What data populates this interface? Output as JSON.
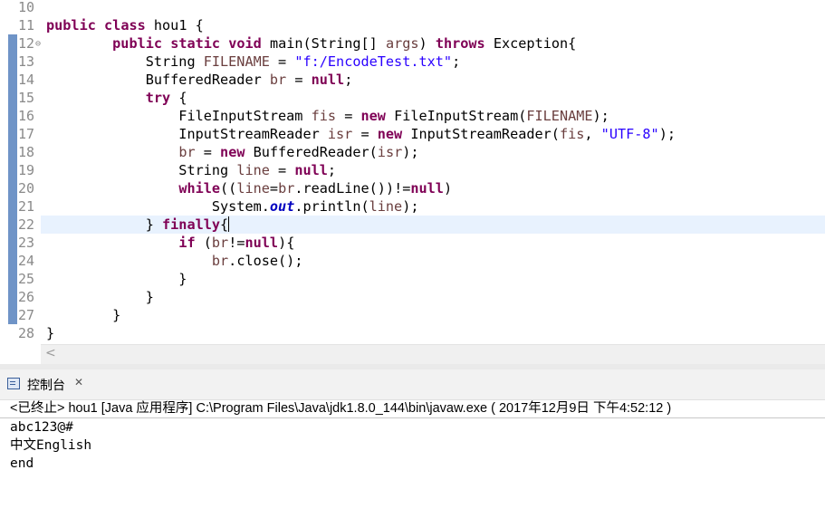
{
  "editor": {
    "line_numbers": [
      "10",
      "11",
      "12",
      "13",
      "14",
      "15",
      "16",
      "17",
      "18",
      "19",
      "20",
      "21",
      "22",
      "23",
      "24",
      "25",
      "26",
      "27",
      "28"
    ],
    "code": {
      "l11": {
        "t1": "public",
        "t2": " ",
        "t3": "class",
        "t4": " hou1 {"
      },
      "l12": {
        "t0": "        ",
        "t1": "public",
        "t2": " ",
        "t3": "static",
        "t4": " ",
        "t5": "void",
        "t6": " main(String[] ",
        "t7": "args",
        "t8": ") ",
        "t9": "throws",
        "t10": " Exception{"
      },
      "l13": {
        "t0": "            String ",
        "t1": "FILENAME",
        "t2": " = ",
        "t3": "\"f:/EncodeTest.txt\"",
        "t4": ";"
      },
      "l14": {
        "t0": "            BufferedReader ",
        "t1": "br",
        "t2": " = ",
        "t3": "null",
        "t4": ";"
      },
      "l15": {
        "t0": "            ",
        "t1": "try",
        "t2": " {"
      },
      "l16": {
        "t0": "                FileInputStream ",
        "t1": "fis",
        "t2": " = ",
        "t3": "new",
        "t4": " FileInputStream(",
        "t5": "FILENAME",
        "t6": ");"
      },
      "l17": {
        "t0": "                InputStreamReader ",
        "t1": "isr",
        "t2": " = ",
        "t3": "new",
        "t4": " InputStreamReader(",
        "t5": "fis",
        "t6": ", ",
        "t7": "\"UTF-8\"",
        "t8": ");"
      },
      "l18": {
        "t0": "                ",
        "t1": "br",
        "t2": " = ",
        "t3": "new",
        "t4": " BufferedReader(",
        "t5": "isr",
        "t6": ");"
      },
      "l19": {
        "t0": "                String ",
        "t1": "line",
        "t2": " = ",
        "t3": "null",
        "t4": ";"
      },
      "l20": {
        "t0": "                ",
        "t1": "while",
        "t2": "((",
        "t3": "line",
        "t4": "=",
        "t5": "br",
        "t6": ".readLine())!=",
        "t7": "null",
        "t8": ")"
      },
      "l21": {
        "t0": "                    System.",
        "t1": "out",
        "t2": ".println(",
        "t3": "line",
        "t4": ");"
      },
      "l22": {
        "t0": "            } ",
        "t1": "finally",
        "t2": "{"
      },
      "l23": {
        "t0": "                ",
        "t1": "if",
        "t2": " (",
        "t3": "br",
        "t4": "!=",
        "t5": "null",
        "t6": "){"
      },
      "l24": {
        "t0": "                    ",
        "t1": "br",
        "t2": ".close();"
      },
      "l25": {
        "t0": "                }"
      },
      "l26": {
        "t0": "            }"
      },
      "l27": {
        "t0": "        }"
      },
      "l28": {
        "t0": "}"
      }
    },
    "scroll_left_label": "<"
  },
  "console": {
    "tab_label": "控制台",
    "tab_close": "✕",
    "header": "<已终止> hou1 [Java 应用程序] C:\\Program Files\\Java\\jdk1.8.0_144\\bin\\javaw.exe ( 2017年12月9日 下午4:52:12 )",
    "output": [
      "abc123@#",
      "中文English",
      "end"
    ]
  },
  "colors": {
    "keyword": "#7f0055",
    "string": "#2a00ff",
    "local_var": "#6a3e3e",
    "constant": "#0000c0",
    "current_line": "#e8f2fe",
    "change_marker": "#6f94c7"
  },
  "icons": [
    "fold-collapse-icon",
    "console-view-icon",
    "close-icon"
  ]
}
